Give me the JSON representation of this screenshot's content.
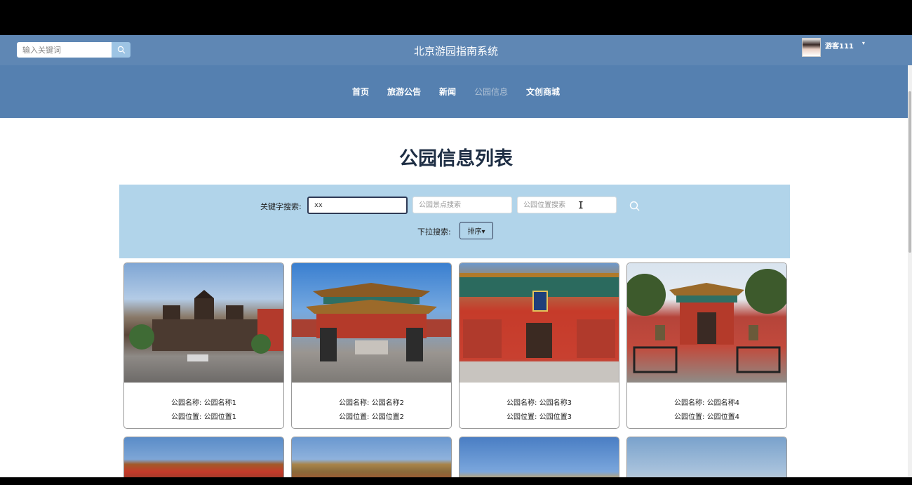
{
  "header": {
    "search_placeholder": "输入关键词",
    "site_title": "北京游园指南系统",
    "user_name": "游客111",
    "caret": "▾"
  },
  "nav": {
    "items": [
      {
        "label": "首页",
        "active": false
      },
      {
        "label": "旅游公告",
        "active": false
      },
      {
        "label": "新闻",
        "active": false
      },
      {
        "label": "公园信息",
        "active": true
      },
      {
        "label": "文创商城",
        "active": false
      }
    ]
  },
  "page": {
    "title": "公园信息列表"
  },
  "filter": {
    "keyword_label": "关键字搜索:",
    "keyword_value": "xx",
    "scenic_placeholder": "公园景点搜索",
    "location_placeholder": "公园位置搜索",
    "dropdown_label": "下拉搜索:",
    "sort_label": "排序▾"
  },
  "cards": [
    {
      "name_line": "公园名称: 公园名称1",
      "location_line": "公园位置: 公园位置1"
    },
    {
      "name_line": "公园名称: 公园名称2",
      "location_line": "公园位置: 公园位置2"
    },
    {
      "name_line": "公园名称: 公园名称3",
      "location_line": "公园位置: 公园位置3"
    },
    {
      "name_line": "公园名称: 公园名称4",
      "location_line": "公园位置: 公园位置4"
    }
  ],
  "colors": {
    "header": "#5f87b4",
    "navbar": "#5580b0",
    "filter_panel": "#b1d4ea",
    "title": "#1e2e44"
  }
}
